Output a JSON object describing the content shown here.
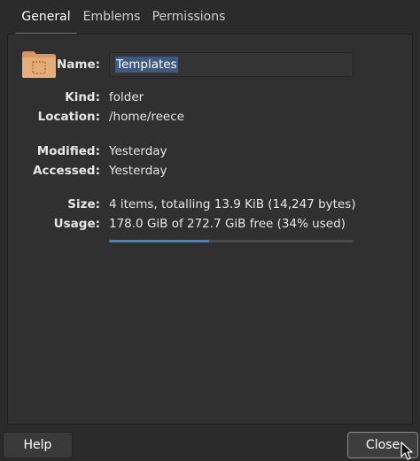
{
  "tabs": [
    {
      "label": "General",
      "active": true
    },
    {
      "label": "Emblems",
      "active": false
    },
    {
      "label": "Permissions",
      "active": false
    }
  ],
  "general": {
    "name_label": "Name:",
    "name_value": "Templates",
    "kind_label": "Kind:",
    "kind_value": "folder",
    "location_label": "Location:",
    "location_value": "/home/reece",
    "modified_label": "Modified:",
    "modified_value": "Yesterday",
    "accessed_label": "Accessed:",
    "accessed_value": "Yesterday",
    "size_label": "Size:",
    "size_value": "4 items, totalling 13.9 KiB (14,247 bytes)",
    "usage_label": "Usage:",
    "usage_value": "178.0 GiB of 272.7 GiB free (34% used)",
    "usage_fraction": 0.41
  },
  "buttons": {
    "help_label": "Help",
    "close_label": "Close"
  },
  "icons": {
    "folder": "folder-icon",
    "cursor": "mouse-pointer-icon"
  },
  "colors": {
    "accent": "#3f83d9",
    "background": "#2b2b2b",
    "folder": "#e0a36c"
  }
}
